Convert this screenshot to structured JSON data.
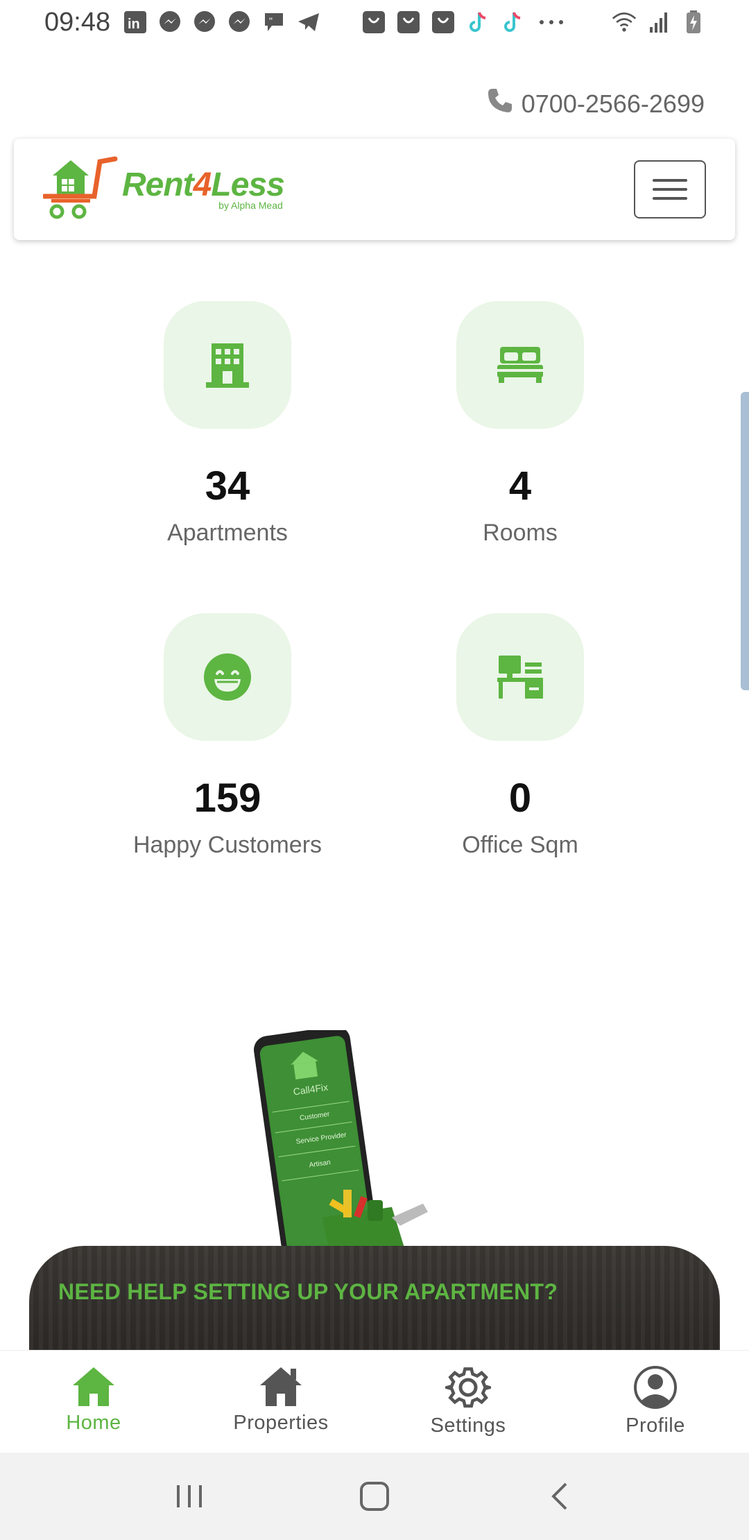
{
  "status_bar": {
    "time": "09:48",
    "notification_icons": [
      "linkedin-icon",
      "messenger-icon",
      "messenger-icon",
      "messenger-icon",
      "quote-icon",
      "telegram-icon",
      "shop-icon",
      "shop-icon",
      "shop-icon",
      "tiktok-icon",
      "tiktok-icon",
      "more-icon"
    ],
    "system_icons": [
      "wifi-icon",
      "signal-icon",
      "battery-charging-icon"
    ]
  },
  "contact": {
    "phone": "0700-2566-2699"
  },
  "header": {
    "brand_main": "Rent",
    "brand_four": "4",
    "brand_less": "Less",
    "brand_sub": "by Alpha Mead",
    "menu_icon": "hamburger-icon"
  },
  "stats": [
    {
      "icon": "building-icon",
      "value": "34",
      "label": "Apartments"
    },
    {
      "icon": "bed-icon",
      "value": "4",
      "label": "Rooms"
    },
    {
      "icon": "smile-icon",
      "value": "159",
      "label": "Happy Customers"
    },
    {
      "icon": "office-desk-icon",
      "value": "0",
      "label": "Office Sqm"
    }
  ],
  "promo": {
    "headline": "NEED HELP SETTING UP YOUR APARTMENT?",
    "phone_brand": "Call4Fix",
    "phone_menu": [
      "Customer",
      "Service Provider",
      "Artisan"
    ]
  },
  "bottom_nav": [
    {
      "icon": "home-icon",
      "label": "Home",
      "active": true
    },
    {
      "icon": "properties-icon",
      "label": "Properties",
      "active": false
    },
    {
      "icon": "settings-icon",
      "label": "Settings",
      "active": false
    },
    {
      "icon": "profile-icon",
      "label": "Profile",
      "active": false
    }
  ],
  "colors": {
    "brand_green": "#5db542",
    "brand_orange": "#e8622b",
    "icon_bg": "#eaf6e7",
    "nav_inactive": "#555555"
  }
}
